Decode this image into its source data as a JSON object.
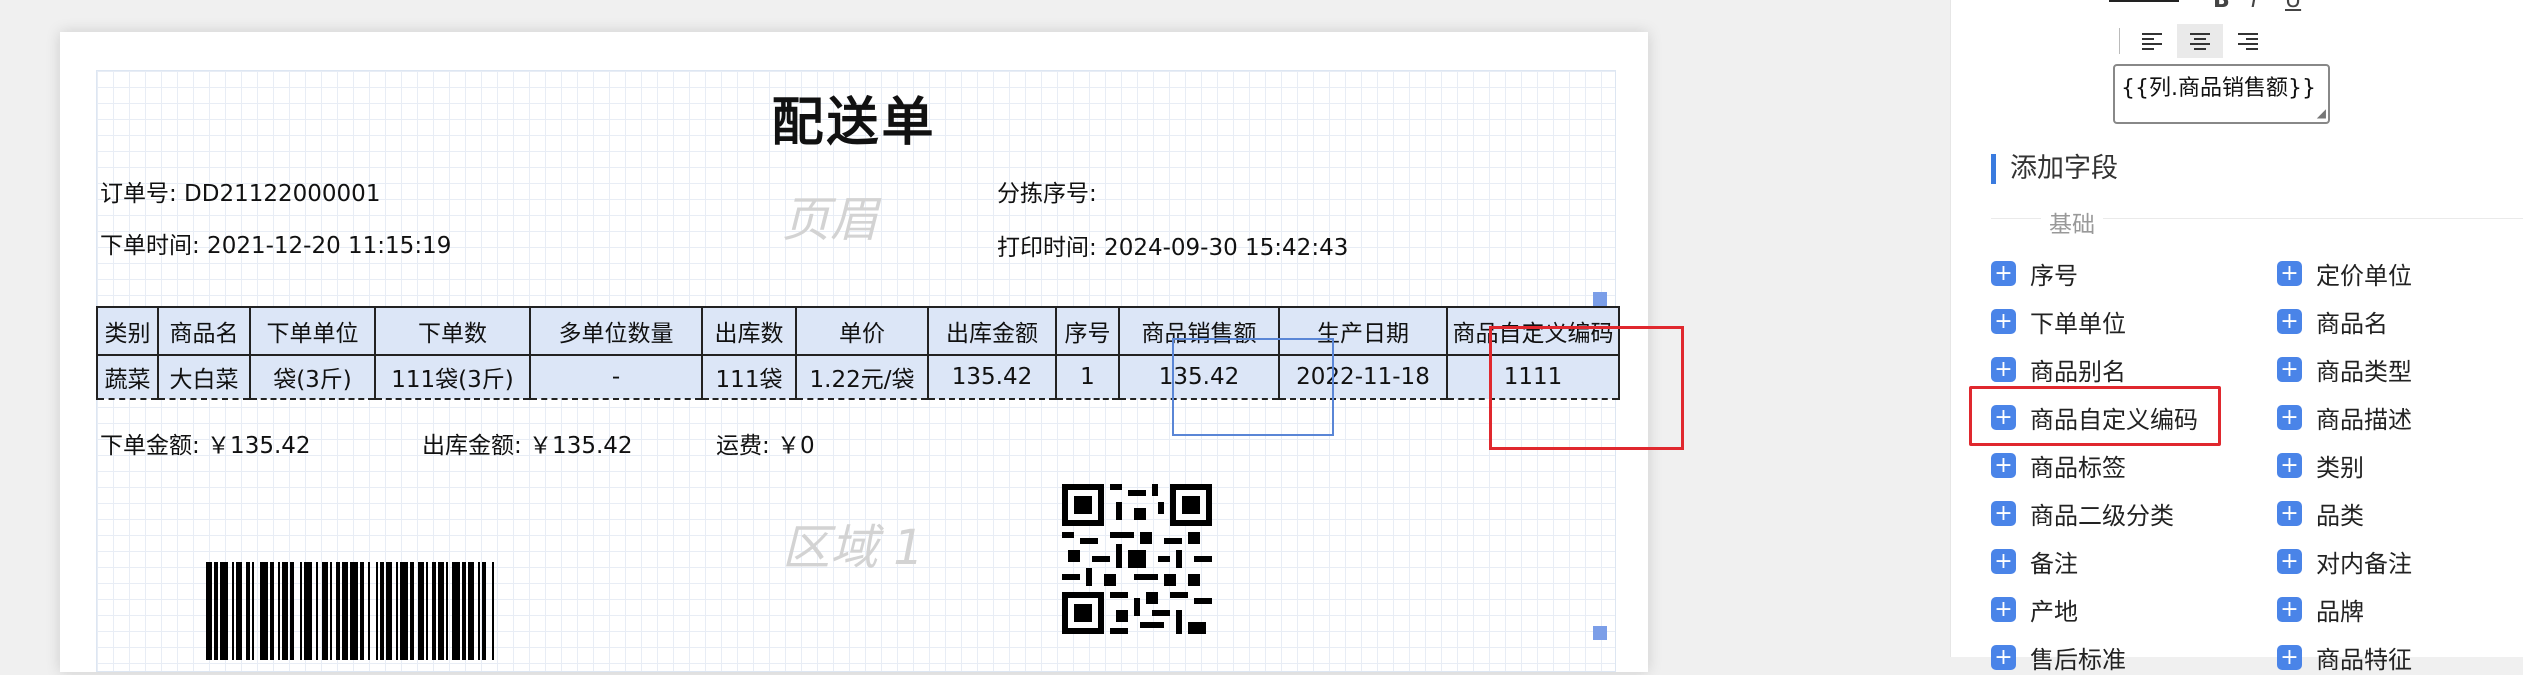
{
  "document": {
    "title": "配送单",
    "order_no": "订单号: DD21122000001",
    "sort_no": "分拣序号:",
    "order_time": "下单时间:  2021-12-20 11:15:19",
    "print_time": "打印时间:  2024-09-30 15:42:43",
    "watermark_header": "页眉",
    "watermark_region": "区域 1",
    "table_headers": [
      "类别",
      "商品名",
      "下单单位",
      "下单数",
      "多单位数量",
      "出库数",
      "单价",
      "出库金额",
      "序号",
      "商品销售额",
      "生产日期",
      "商品自定义编码"
    ],
    "table_row": [
      "蔬菜",
      "大白菜",
      "袋(3斤)",
      "111袋(3斤)",
      "-",
      "111袋",
      "1.22元/袋",
      "135.42",
      "1",
      "135.42",
      "2022-11-18",
      "1111"
    ],
    "order_amount": "下单金额: ￥135.42",
    "out_amount": "出库金额: ￥135.42",
    "freight": "运费: ￥0"
  },
  "panel": {
    "format_bold": "B",
    "format_italic": "I",
    "format_underline": "U",
    "text_value": "{{列.商品销售额}}",
    "section_title": "添加字段",
    "group_label": "基础",
    "fields_left": [
      "序号",
      "下单单位",
      "商品别名",
      "商品自定义编码",
      "商品标签",
      "商品二级分类",
      "备注",
      "产地",
      "售后标准"
    ],
    "fields_right": [
      "定价单位",
      "商品名",
      "商品类型",
      "商品描述",
      "类别",
      "品类",
      "对内备注",
      "品牌",
      "商品特征"
    ]
  },
  "colors": {
    "accent": "#4a84e8",
    "highlight_red": "#e0282e",
    "table_fill": "#dce6f7"
  }
}
